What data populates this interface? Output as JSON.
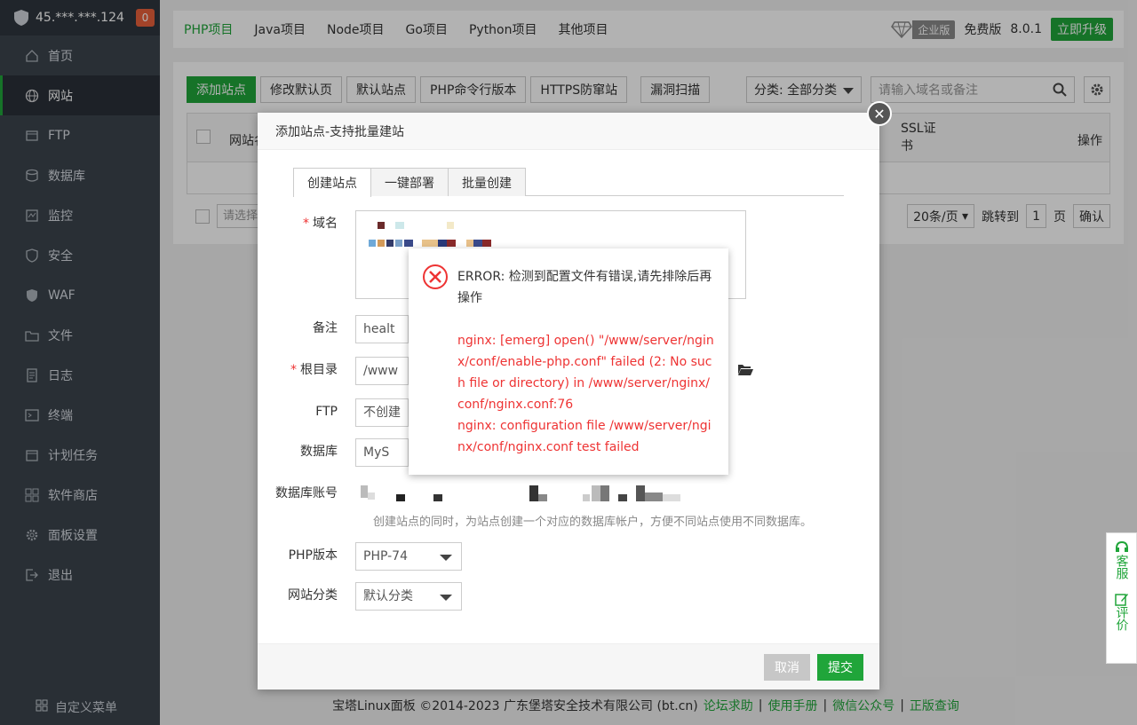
{
  "sidebar": {
    "server_ip": "45.***.***.124",
    "notification_count": "0",
    "items": [
      {
        "label": "首页",
        "icon": "home-icon"
      },
      {
        "label": "网站",
        "icon": "globe-icon"
      },
      {
        "label": "FTP",
        "icon": "ftp-icon"
      },
      {
        "label": "数据库",
        "icon": "database-icon"
      },
      {
        "label": "监控",
        "icon": "monitor-icon"
      },
      {
        "label": "安全",
        "icon": "shield-icon"
      },
      {
        "label": "WAF",
        "icon": "waf-shield-icon"
      },
      {
        "label": "文件",
        "icon": "folder-icon"
      },
      {
        "label": "日志",
        "icon": "log-icon"
      },
      {
        "label": "终端",
        "icon": "terminal-icon"
      },
      {
        "label": "计划任务",
        "icon": "calendar-icon"
      },
      {
        "label": "软件商店",
        "icon": "grid-icon"
      },
      {
        "label": "面板设置",
        "icon": "gear-icon"
      },
      {
        "label": "退出",
        "icon": "logout-icon"
      }
    ],
    "custom_menu": "自定义菜单",
    "active_color": "#20a53a"
  },
  "topbar": {
    "tabs": [
      "PHP项目",
      "Java项目",
      "Node项目",
      "Go项目",
      "Python项目",
      "其他项目"
    ],
    "enterprise_label": "企业版",
    "free_label": "免费版",
    "version": "8.0.1",
    "upgrade_label": "立即升级"
  },
  "toolbar": {
    "buttons": [
      "添加站点",
      "修改默认页",
      "默认站点",
      "PHP命令行版本",
      "HTTPS防窜站",
      "漏洞扫描"
    ],
    "category_select": "分类: 全部分类",
    "search_placeholder": "请输入域名或备注"
  },
  "table": {
    "col_site": "网站名",
    "col_ssl": "SSL证书",
    "col_ops": "操作",
    "batch_placeholder": "请选择",
    "per_page": "20条/页",
    "goto_label": "跳转到",
    "page_value": "1",
    "page_unit": "页",
    "confirm": "确认"
  },
  "modal": {
    "title": "添加站点-支持批量建站",
    "tabs": [
      "创建站点",
      "一键部署",
      "批量创建"
    ],
    "domain_label": "域名",
    "remark_label": "备注",
    "remark_value": "healt",
    "root_label": "根目录",
    "root_value": "/www",
    "ftp_label": "FTP",
    "ftp_value": "不创建",
    "db_label": "数据库",
    "db_value": "MyS",
    "db_account_label": "数据库账号",
    "db_hint": "创建站点的同时，为站点创建一个对应的数据库帐户，方便不同站点使用不同数据库。",
    "php_label": "PHP版本",
    "php_value": "PHP-74",
    "category_label": "网站分类",
    "category_value": "默认分类",
    "cancel": "取消",
    "submit": "提交"
  },
  "error": {
    "title": "ERROR: 检测到配置文件有错误,请先排除后再操作",
    "line1": "nginx: [emerg] open() \"/www/server/nginx/conf/enable-php.conf\" failed (2: No such file or directory) in /www/server/nginx/conf/nginx.conf:76",
    "line2": "nginx: configuration file /www/server/nginx/conf/nginx.conf test failed",
    "color": "#e33"
  },
  "footer": {
    "copyright": "宝塔Linux面板 ©2014-2023 广东堡塔安全技术有限公司 (bt.cn)",
    "links": [
      "论坛求助",
      "使用手册",
      "微信公众号",
      "正版查询"
    ]
  },
  "float_side": {
    "service": "客服",
    "review": "评价"
  }
}
